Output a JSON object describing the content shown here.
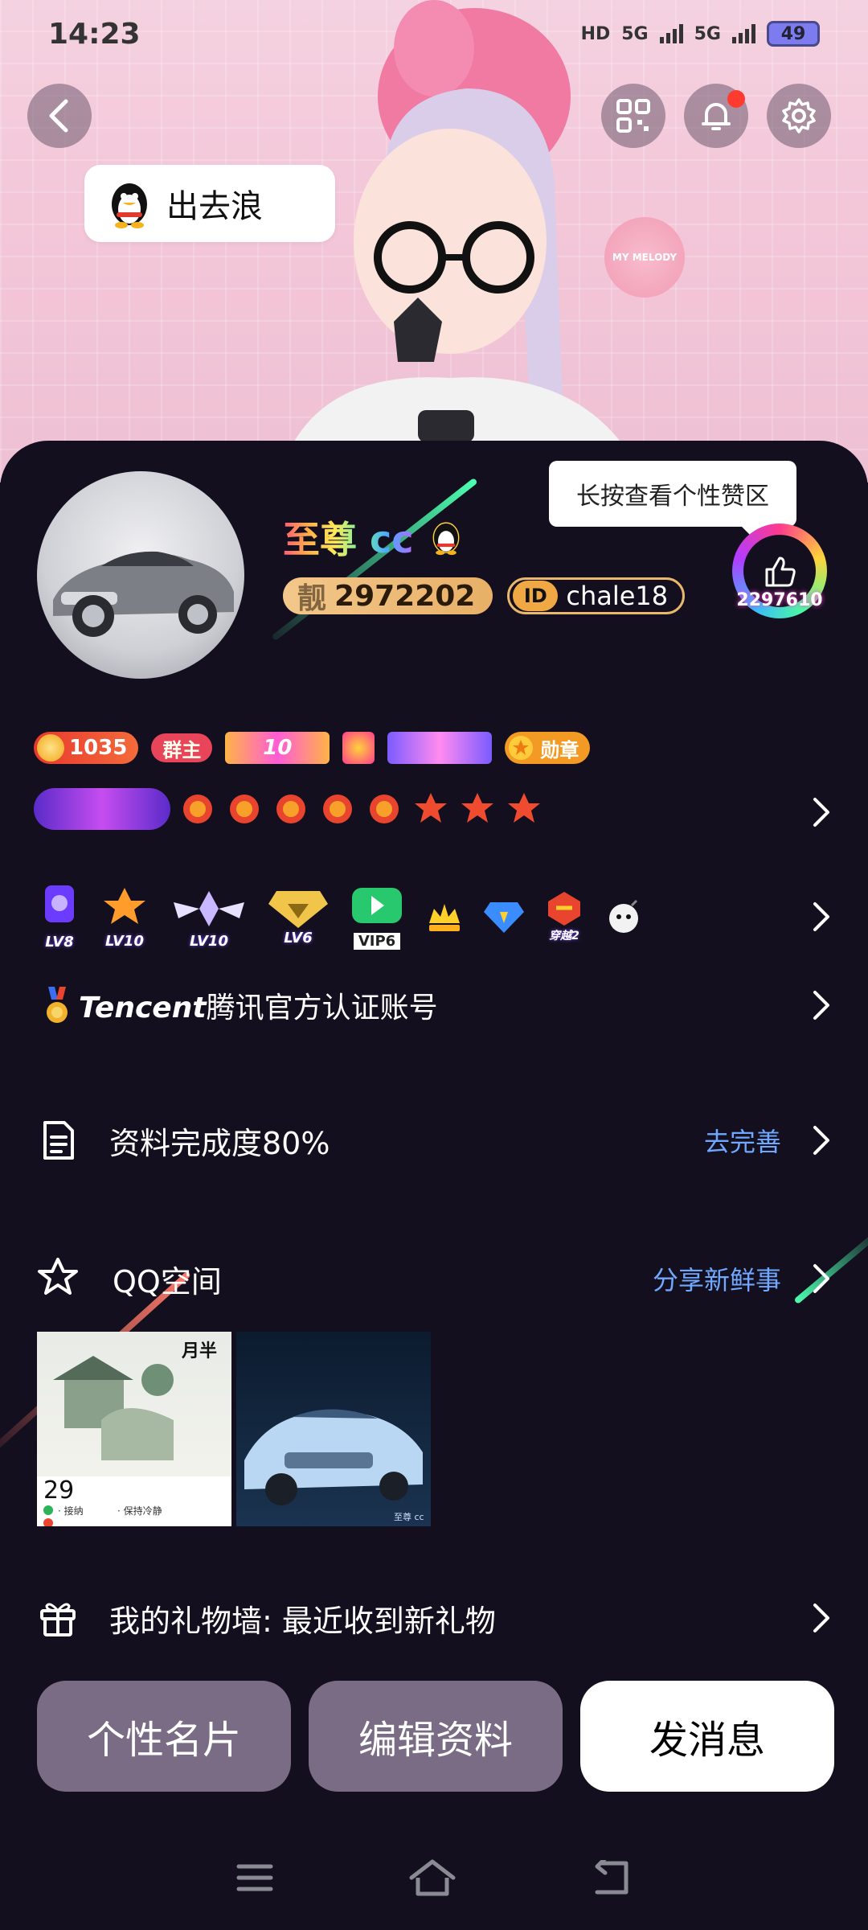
{
  "status": {
    "time": "14:23",
    "hd": "HD",
    "net1": "5G",
    "net2": "5G",
    "battery": "49"
  },
  "header": {
    "speech_text": "出去浪",
    "melody_badge": "MY MELODY"
  },
  "profile": {
    "name": "至尊 cc",
    "uid_prefix": "靓",
    "uid": "2972202",
    "id_badge": "ID",
    "id_value": "chale18",
    "tooltip": "长按查看个性赞区",
    "like_count": "2297610"
  },
  "badges": {
    "coin": "1035",
    "group_owner": "群主",
    "level_badge": "10",
    "medal": "勋章"
  },
  "vip": [
    {
      "label": "LV8"
    },
    {
      "label": "LV10"
    },
    {
      "label": "LV10"
    },
    {
      "label": "LV6"
    },
    {
      "label": "VIP6"
    },
    {
      "label": ""
    },
    {
      "label": ""
    },
    {
      "label": "穿越2"
    },
    {
      "label": ""
    }
  ],
  "verify": {
    "brand": "Tencent",
    "text": "腾讯官方认证账号"
  },
  "info": {
    "label": "资料完成度80%",
    "action": "去完善"
  },
  "space": {
    "label": "QQ空间",
    "action": "分享新鲜事",
    "thumb1": {
      "month": "月半",
      "day": "29",
      "lines": [
        "· 接纳",
        "· 保持冷静"
      ]
    },
    "thumb2": {
      "caption": "至尊 cc"
    }
  },
  "gift": {
    "label": "我的礼物墙: 最近收到新礼物"
  },
  "buttons": {
    "card": "个性名片",
    "edit": "编辑资料",
    "message": "发消息"
  },
  "colors": {
    "panel": "#140f1e",
    "link": "#6fa8ff",
    "button_muted": "#7a6c84"
  }
}
